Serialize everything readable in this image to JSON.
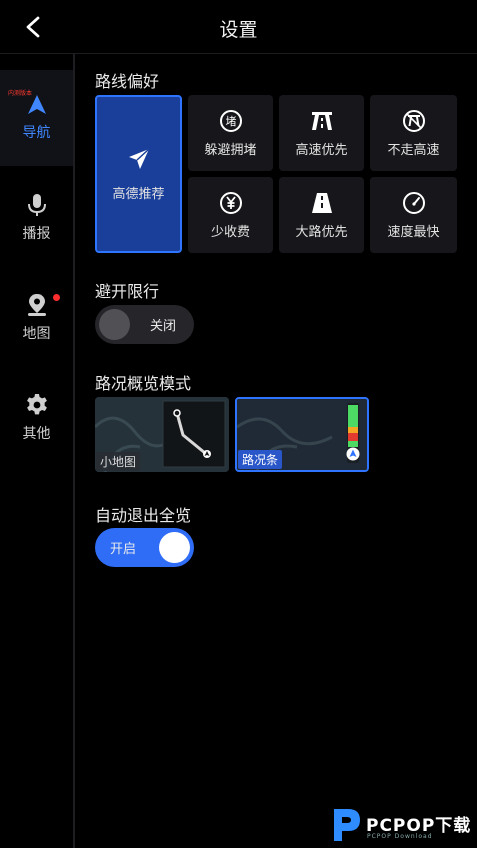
{
  "header": {
    "title": "设置"
  },
  "sidebar": {
    "beta_tag": "内测版本",
    "items": [
      {
        "label": "导航",
        "icon": "navigation-arrow-icon",
        "active": true
      },
      {
        "label": "播报",
        "icon": "microphone-icon"
      },
      {
        "label": "地图",
        "icon": "map-pin-icon",
        "badge": true
      },
      {
        "label": "其他",
        "icon": "gear-icon"
      }
    ]
  },
  "route_pref": {
    "title": "路线偏好",
    "recommended": "高德推荐",
    "options": [
      "躲避拥堵",
      "高速优先",
      "不走高速",
      "少收费",
      "大路优先",
      "速度最快"
    ]
  },
  "restriction": {
    "title": "避开限行",
    "toggle_label": "关闭",
    "enabled": false
  },
  "overview": {
    "title": "路况概览模式",
    "modes": [
      "小地图",
      "路况条"
    ],
    "selected": "路况条"
  },
  "auto_exit": {
    "title": "自动退出全览",
    "toggle_label": "开启",
    "enabled": true
  },
  "watermark": {
    "brand": "PCPOP下载",
    "sub": "PCPOP Download"
  },
  "colors": {
    "accent": "#2f74ff",
    "active_text": "#3f86ff",
    "selected_card": "#1a3f9a",
    "badge": "#ff2d2d"
  }
}
